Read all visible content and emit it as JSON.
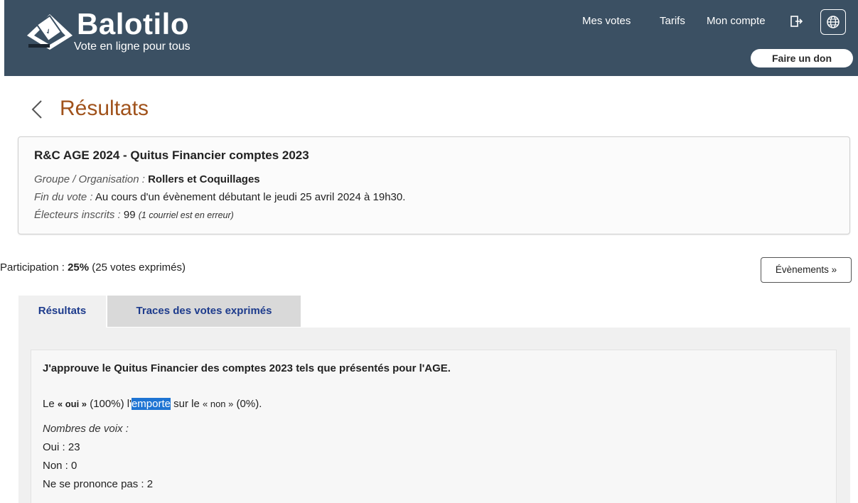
{
  "header": {
    "brand": "Balotilo",
    "tagline": "Vote en ligne pour tous",
    "nav": {
      "mes_votes": "Mes votes",
      "tarifs": "Tarifs",
      "mon_compte": "Mon compte"
    },
    "donate_label": "Faire un don",
    "icons": [
      "logo-ballot-icon",
      "logout-icon",
      "globe-icon"
    ],
    "bg_color": "#3b5063"
  },
  "page": {
    "title": "Résultats",
    "title_color": "#a0521b"
  },
  "vote": {
    "title": "R&C AGE 2024 - Quitus Financier comptes 2023",
    "group_label": "Groupe / Organisation :",
    "group_value": "Rollers et Coquillages",
    "end_label": "Fin du vote :",
    "end_value": "Au cours d'un évènement débutant le jeudi 25 avril 2024 à 19h30.",
    "voters_label": "Électeurs inscrits :",
    "voters_value": "99",
    "voters_note": "(1 courriel est en erreur)"
  },
  "participation": {
    "label": "Participation :",
    "percent": "25%",
    "detail": "(25 votes exprimés)",
    "events_button": "Évènements »"
  },
  "tabs": [
    {
      "label": "Résultats",
      "active": true
    },
    {
      "label": "Traces des votes exprimés",
      "active": false
    }
  ],
  "result": {
    "question": "J'approuve le Quitus Financier des comptes 2023 tels que présentés pour l'AGE.",
    "verdict_prefix": "Le",
    "verdict_oui": "« oui »",
    "verdict_oui_pct": "(100%) l'",
    "verdict_highlight": "emporte",
    "verdict_mid": "sur le",
    "verdict_non": "« non »",
    "verdict_non_pct": "(0%).",
    "counts_label": "Nombres de voix :",
    "counts": [
      {
        "label": "Oui :",
        "value": "23"
      },
      {
        "label": "Non :",
        "value": "0"
      },
      {
        "label": "Ne se prononce pas :",
        "value": "2"
      }
    ],
    "highlight_color": "#1e74d3"
  }
}
